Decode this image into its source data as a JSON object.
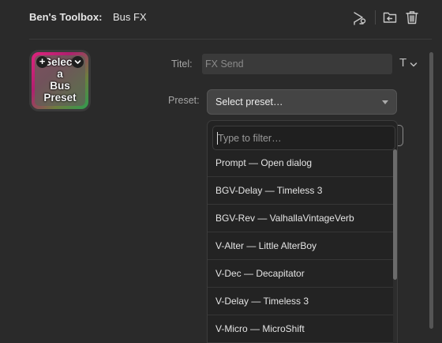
{
  "header": {
    "app_title": "Ben's Toolbox:",
    "doc_title": "Bus FX",
    "icons": [
      "route-icon",
      "folder-icon",
      "trash-icon"
    ]
  },
  "thumbnail": {
    "text": "Select\na\nBus\nPreset",
    "plus_label": "+",
    "colors": {
      "top_left": "#e0237e",
      "bottom_right": "#2f9c4f"
    }
  },
  "form": {
    "title_label": "Titel:",
    "title_value": "FX Send",
    "type_icon": "T",
    "preset_label": "Preset:",
    "preset_value": "Select preset…"
  },
  "dropdown": {
    "filter_placeholder": "Type to filter…",
    "options": [
      "Prompt — Open dialog",
      "BGV-Delay — Timeless 3",
      "BGV-Rev — ValhallaVintageVerb",
      "V-Alter — Little AlterBoy",
      "V-Dec — Decapitator",
      "V-Delay — Timeless 3",
      "V-Micro — MicroShift"
    ]
  },
  "behind_button_glyph": "s",
  "colors": {
    "background": "#2a2a2a",
    "input": "#3a3a3a",
    "dropdown": "#232323"
  }
}
